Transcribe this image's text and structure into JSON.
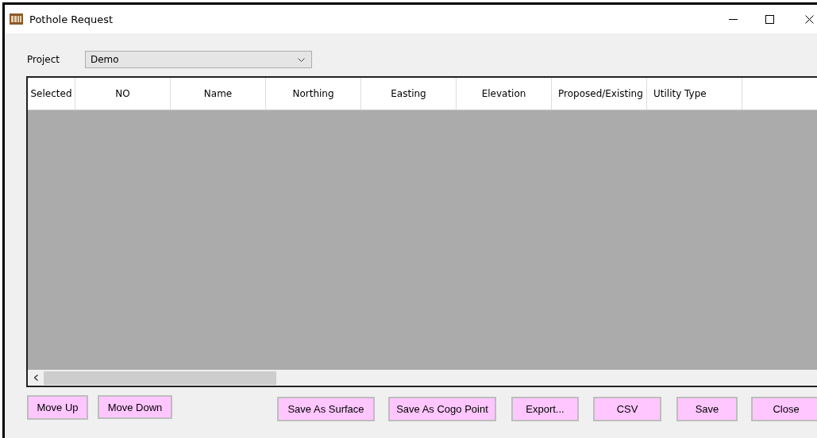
{
  "window": {
    "title": "Pothole Request"
  },
  "project": {
    "label": "Project",
    "value": "Demo"
  },
  "table": {
    "columns": [
      "Selected",
      "NO",
      "Name",
      "Northing",
      "Easting",
      "Elevation",
      "Proposed/Existing",
      "Utility Type"
    ]
  },
  "buttons": [
    {
      "label": "Move Up"
    },
    {
      "label": "Move Down"
    },
    {
      "label": "Save As Surface"
    },
    {
      "label": "Save As Cogo Point"
    },
    {
      "label": "Export..."
    },
    {
      "label": "CSV"
    },
    {
      "label": "Save"
    },
    {
      "label": "Close"
    }
  ]
}
